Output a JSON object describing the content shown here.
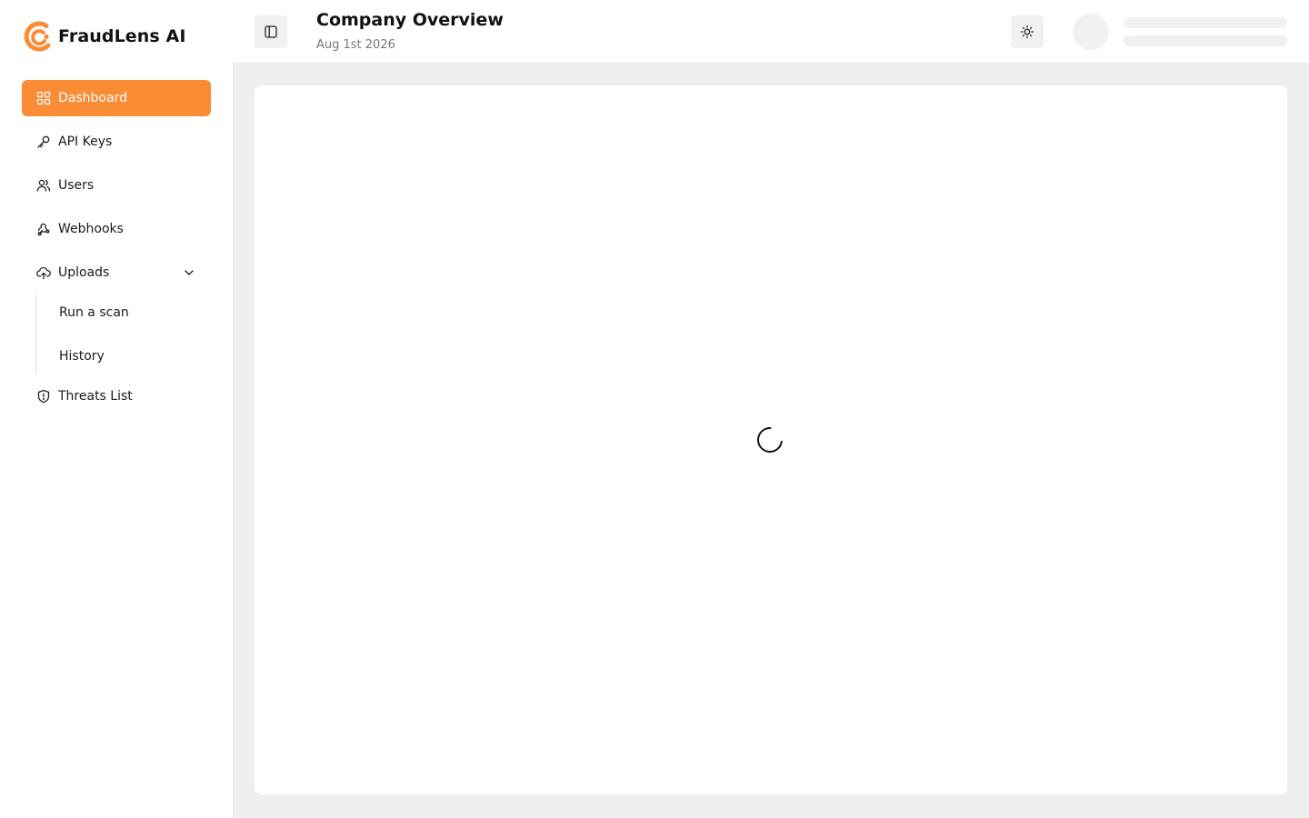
{
  "brand": {
    "name": "FraudLens AI",
    "accent": "#fb8c36"
  },
  "sidebar": {
    "items": [
      {
        "label": "Dashboard",
        "icon": "dashboard-grid-icon",
        "active": true
      },
      {
        "label": "API Keys",
        "icon": "key-icon"
      },
      {
        "label": "Users",
        "icon": "users-icon"
      },
      {
        "label": "Webhooks",
        "icon": "webhook-icon"
      },
      {
        "label": "Uploads",
        "icon": "cloud-upload-icon",
        "expanded": true,
        "children": [
          {
            "label": "Run a scan"
          },
          {
            "label": "History"
          }
        ]
      },
      {
        "label": "Threats List",
        "icon": "shield-alert-icon"
      }
    ]
  },
  "header": {
    "title": "Company Overview",
    "date": "Aug 1st 2026",
    "sidebar_toggle_icon": "panel-left-icon",
    "theme_icon": "sun-icon"
  },
  "main": {
    "state": "loading",
    "spinner_icon": "loader-icon"
  }
}
